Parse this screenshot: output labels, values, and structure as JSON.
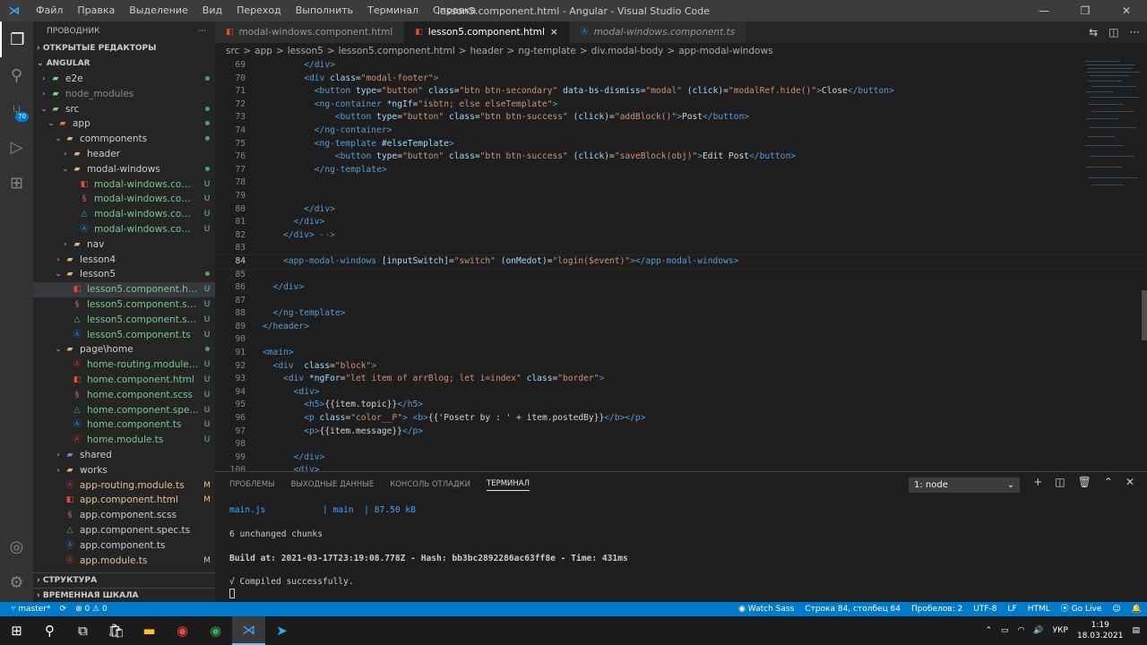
{
  "titlebar": {
    "menu": [
      "Файл",
      "Правка",
      "Выделение",
      "Вид",
      "Переход",
      "Выполнить",
      "Терминал",
      "Справка"
    ],
    "title": "lesson5.component.html - Angular - Visual Studio Code"
  },
  "activity": {
    "badge": "70"
  },
  "sidebar": {
    "title": "ПРОВОДНИК",
    "more": "···",
    "open_editors": "ОТКРЫТЫЕ РЕДАКТОРЫ",
    "workspace": "ANGULAR",
    "tree": [
      {
        "d": 0,
        "t": "f",
        "o": false,
        "n": "e2e",
        "s": "dot",
        "c": "#89d185"
      },
      {
        "d": 0,
        "t": "f",
        "o": false,
        "n": "node_modules",
        "s": "",
        "c": "#89d185",
        "dim": true
      },
      {
        "d": 0,
        "t": "f",
        "o": true,
        "n": "src",
        "s": "dot",
        "c": "#89d185"
      },
      {
        "d": 1,
        "t": "f",
        "o": true,
        "n": "app",
        "s": "dot",
        "c": "#e37933"
      },
      {
        "d": 2,
        "t": "f",
        "o": true,
        "n": "commponents",
        "s": "dot",
        "c": "#dcb67a"
      },
      {
        "d": 3,
        "t": "f",
        "o": false,
        "n": "header",
        "s": "",
        "c": "#dcb67a"
      },
      {
        "d": 3,
        "t": "f",
        "o": true,
        "n": "modal-windows",
        "s": "dot",
        "c": "#dcb67a"
      },
      {
        "d": 4,
        "t": "h",
        "n": "modal-windows.compo...",
        "s": "U"
      },
      {
        "d": 4,
        "t": "c",
        "n": "modal-windows.compo...",
        "s": "U"
      },
      {
        "d": 4,
        "t": "p",
        "n": "modal-windows.compo...",
        "s": "U"
      },
      {
        "d": 4,
        "t": "a",
        "n": "modal-windows.compo...",
        "s": "U"
      },
      {
        "d": 3,
        "t": "f",
        "o": false,
        "n": "nav",
        "s": "",
        "c": "#dcb67a"
      },
      {
        "d": 2,
        "t": "f",
        "o": false,
        "n": "lesson4",
        "s": "",
        "c": "#dcb67a"
      },
      {
        "d": 2,
        "t": "f",
        "o": true,
        "n": "lesson5",
        "s": "dot",
        "c": "#dcb67a"
      },
      {
        "d": 3,
        "t": "h",
        "n": "lesson5.component.html",
        "s": "U",
        "sel": true
      },
      {
        "d": 3,
        "t": "c",
        "n": "lesson5.component.scss",
        "s": "U"
      },
      {
        "d": 3,
        "t": "p",
        "n": "lesson5.component.spec.ts",
        "s": "U"
      },
      {
        "d": 3,
        "t": "a",
        "n": "lesson5.component.ts",
        "s": "U"
      },
      {
        "d": 2,
        "t": "f",
        "o": true,
        "n": "page\\home",
        "s": "dot",
        "c": "#dcb67a"
      },
      {
        "d": 3,
        "t": "r",
        "n": "home-routing.module.ts",
        "s": "U"
      },
      {
        "d": 3,
        "t": "h",
        "n": "home.component.html",
        "s": "U"
      },
      {
        "d": 3,
        "t": "c",
        "n": "home.component.scss",
        "s": "U"
      },
      {
        "d": 3,
        "t": "p",
        "n": "home.component.spec.ts",
        "s": "U"
      },
      {
        "d": 3,
        "t": "a",
        "n": "home.component.ts",
        "s": "U"
      },
      {
        "d": 3,
        "t": "r",
        "n": "home.module.ts",
        "s": "U"
      },
      {
        "d": 2,
        "t": "f",
        "o": false,
        "n": "shared",
        "s": "",
        "c": "#a074c4"
      },
      {
        "d": 2,
        "t": "f",
        "o": false,
        "n": "works",
        "s": "",
        "c": "#dcb67a"
      },
      {
        "d": 2,
        "t": "r",
        "n": "app-routing.module.ts",
        "s": "M"
      },
      {
        "d": 2,
        "t": "h",
        "n": "app.component.html",
        "s": "M"
      },
      {
        "d": 2,
        "t": "c",
        "n": "app.component.scss",
        "s": ""
      },
      {
        "d": 2,
        "t": "p",
        "n": "app.component.spec.ts",
        "s": ""
      },
      {
        "d": 2,
        "t": "a",
        "n": "app.component.ts",
        "s": ""
      },
      {
        "d": 2,
        "t": "r",
        "n": "app.module.ts",
        "s": "M"
      }
    ],
    "outline": "СТРУКТУРА",
    "timeline": "ВРЕМЕННАЯ ШКАЛА"
  },
  "tabs": [
    {
      "label": "modal-windows.component.html",
      "icon": "html"
    },
    {
      "label": "lesson5.component.html",
      "icon": "html",
      "active": true,
      "close": "×"
    },
    {
      "label": "modal-windows.component.ts",
      "icon": "angular",
      "italic": true
    }
  ],
  "breadcrumb": [
    "src",
    ">",
    "app",
    ">",
    "lesson5",
    ">",
    "lesson5.component.html",
    ">",
    "header",
    ">",
    "ng-template",
    ">",
    "div.modal-body",
    ">",
    "app-modal-windows"
  ],
  "code": [
    {
      "n": "69",
      "l": [
        [
          "",
          "        "
        ],
        [
          "tag",
          "</div>"
        ]
      ]
    },
    {
      "n": "70",
      "l": [
        [
          "",
          "        "
        ],
        [
          "tag",
          "<div "
        ],
        [
          "att",
          "class"
        ],
        [
          "txt",
          "="
        ],
        [
          "str",
          "\"modal-footer\""
        ],
        [
          "tag",
          ">"
        ]
      ]
    },
    {
      "n": "71",
      "l": [
        [
          "",
          "          "
        ],
        [
          "tag",
          "<button "
        ],
        [
          "att",
          "type"
        ],
        [
          "txt",
          "="
        ],
        [
          "str",
          "\"button\" "
        ],
        [
          "att",
          "class"
        ],
        [
          "txt",
          "="
        ],
        [
          "str",
          "\"btn btn-secondary\" "
        ],
        [
          "att",
          "data-bs-dismiss"
        ],
        [
          "txt",
          "="
        ],
        [
          "str",
          "\"modal\" "
        ],
        [
          "att",
          "(click)"
        ],
        [
          "txt",
          "="
        ],
        [
          "str",
          "\"modalRef.hide()\""
        ],
        [
          "tag",
          ">"
        ],
        [
          "txt",
          "Close"
        ],
        [
          "tag",
          "</button>"
        ]
      ]
    },
    {
      "n": "72",
      "l": [
        [
          "",
          "          "
        ],
        [
          "tag",
          "<ng-container "
        ],
        [
          "att",
          "*ngIf"
        ],
        [
          "txt",
          "="
        ],
        [
          "str",
          "\"isbtn; else elseTemplate\""
        ],
        [
          "tag",
          ">"
        ]
      ]
    },
    {
      "n": "73",
      "l": [
        [
          "",
          "              "
        ],
        [
          "tag",
          "<button "
        ],
        [
          "att",
          "type"
        ],
        [
          "txt",
          "="
        ],
        [
          "str",
          "\"button\" "
        ],
        [
          "att",
          "class"
        ],
        [
          "txt",
          "="
        ],
        [
          "str",
          "\"btn btn-success\" "
        ],
        [
          "att",
          "(click)"
        ],
        [
          "txt",
          "="
        ],
        [
          "str",
          "\"addBlock()\""
        ],
        [
          "tag",
          ">"
        ],
        [
          "txt",
          "Post"
        ],
        [
          "tag",
          "</button>"
        ]
      ]
    },
    {
      "n": "74",
      "l": [
        [
          "",
          "          "
        ],
        [
          "tag",
          "</ng-container>"
        ]
      ]
    },
    {
      "n": "75",
      "l": [
        [
          "",
          "          "
        ],
        [
          "tag",
          "<ng-template "
        ],
        [
          "att",
          "#elseTemplate"
        ],
        [
          "tag",
          ">"
        ]
      ]
    },
    {
      "n": "76",
      "l": [
        [
          "",
          "              "
        ],
        [
          "tag",
          "<button "
        ],
        [
          "att",
          "type"
        ],
        [
          "txt",
          "="
        ],
        [
          "str",
          "\"button\" "
        ],
        [
          "att",
          "class"
        ],
        [
          "txt",
          "="
        ],
        [
          "str",
          "\"btn btn-success\" "
        ],
        [
          "att",
          "(click)"
        ],
        [
          "txt",
          "="
        ],
        [
          "str",
          "\"saveBlock(obj)\""
        ],
        [
          "tag",
          ">"
        ],
        [
          "txt",
          "Edit Post"
        ],
        [
          "tag",
          "</button>"
        ]
      ]
    },
    {
      "n": "77",
      "l": [
        [
          "",
          "          "
        ],
        [
          "tag",
          "</ng-template>"
        ]
      ]
    },
    {
      "n": "78",
      "l": []
    },
    {
      "n": "79",
      "l": []
    },
    {
      "n": "80",
      "l": [
        [
          "",
          "        "
        ],
        [
          "tag",
          "</div>"
        ]
      ]
    },
    {
      "n": "81",
      "l": [
        [
          "",
          "      "
        ],
        [
          "tag",
          "</div>"
        ]
      ]
    },
    {
      "n": "82",
      "l": [
        [
          "",
          "    "
        ],
        [
          "tag",
          "</div>"
        ],
        [
          "cmt",
          " -->"
        ]
      ]
    },
    {
      "n": "83",
      "l": []
    },
    {
      "n": "84",
      "l": [
        [
          "",
          "    "
        ],
        [
          "tag",
          "<app-modal-windows "
        ],
        [
          "att",
          "[inputSwitch]"
        ],
        [
          "txt",
          "="
        ],
        [
          "str",
          "\"switch\" "
        ],
        [
          "att",
          "(onMedot)"
        ],
        [
          "txt",
          "="
        ],
        [
          "str",
          "\"login($event)\""
        ],
        [
          "tag",
          "></app-modal-windows>"
        ]
      ],
      "cur": true
    },
    {
      "n": "85",
      "l": []
    },
    {
      "n": "86",
      "l": [
        [
          "",
          "  "
        ],
        [
          "tag",
          "</div>"
        ]
      ]
    },
    {
      "n": "87",
      "l": []
    },
    {
      "n": "88",
      "l": [
        [
          "",
          "  "
        ],
        [
          "tag",
          "</ng-template>"
        ]
      ]
    },
    {
      "n": "89",
      "l": [
        [
          "tag",
          "</header>"
        ]
      ]
    },
    {
      "n": "90",
      "l": []
    },
    {
      "n": "91",
      "l": [
        [
          "tag",
          "<main>"
        ]
      ]
    },
    {
      "n": "92",
      "l": [
        [
          "",
          "  "
        ],
        [
          "tag",
          "<div  "
        ],
        [
          "att",
          "class"
        ],
        [
          "txt",
          "="
        ],
        [
          "str",
          "\"block\""
        ],
        [
          "tag",
          ">"
        ]
      ]
    },
    {
      "n": "93",
      "l": [
        [
          "",
          "    "
        ],
        [
          "tag",
          "<div "
        ],
        [
          "att",
          "*ngFor"
        ],
        [
          "txt",
          "="
        ],
        [
          "str",
          "\"let item of arrBlog; let i=index\" "
        ],
        [
          "att",
          "class"
        ],
        [
          "txt",
          "="
        ],
        [
          "str",
          "\"border\""
        ],
        [
          "tag",
          ">"
        ]
      ]
    },
    {
      "n": "94",
      "l": [
        [
          "",
          "      "
        ],
        [
          "tag",
          "<div>"
        ]
      ]
    },
    {
      "n": "95",
      "l": [
        [
          "",
          "        "
        ],
        [
          "tag",
          "<h5>"
        ],
        [
          "txt",
          "{{item.topic}}"
        ],
        [
          "tag",
          "</h5>"
        ]
      ]
    },
    {
      "n": "96",
      "l": [
        [
          "",
          "        "
        ],
        [
          "tag",
          "<p "
        ],
        [
          "att",
          "class"
        ],
        [
          "txt",
          "="
        ],
        [
          "str",
          "\"color__P\""
        ],
        [
          "tag",
          "> <b>"
        ],
        [
          "txt",
          "{{'Posetr by : ' + item.postedBy}}"
        ],
        [
          "tag",
          "</b></p>"
        ]
      ]
    },
    {
      "n": "97",
      "l": [
        [
          "",
          "        "
        ],
        [
          "tag",
          "<p>"
        ],
        [
          "txt",
          "{{item.message}}"
        ],
        [
          "tag",
          "</p>"
        ]
      ]
    },
    {
      "n": "98",
      "l": []
    },
    {
      "n": "99",
      "l": [
        [
          "",
          "      "
        ],
        [
          "tag",
          "</div>"
        ]
      ]
    },
    {
      "n": "100",
      "l": [
        [
          "",
          "      "
        ],
        [
          "tag",
          "<div>"
        ]
      ]
    }
  ],
  "panel": {
    "tabs": [
      "ПРОБЛЕМЫ",
      "ВЫХОДНЫЕ ДАННЫЕ",
      "КОНСОЛЬ ОТЛАДКИ",
      "ТЕРМИНАЛ"
    ],
    "select": "1: node",
    "terminal": [
      "main.js           | main  | 87.50 kB",
      "",
      "6 unchanged chunks",
      "",
      "Build at: 2021-03-17T23:19:08.778Z - Hash: bb3bc2892286ac63ff8e - Time: 431ms",
      "",
      "√ Compiled successfully."
    ]
  },
  "status": {
    "branch": "master*",
    "errors": "⊗ 0 ⚠ 0",
    "watch": "Watch Sass",
    "pos": "Строка 84, столбец 64",
    "spaces": "Пробелов: 2",
    "enc": "UTF-8",
    "eol": "LF",
    "lang": "HTML",
    "live": "Go Live"
  },
  "taskbar": {
    "lang": "УКР",
    "time": "1:19",
    "date": "18.03.2021"
  },
  "colors": {
    "accent": "#007acc"
  }
}
